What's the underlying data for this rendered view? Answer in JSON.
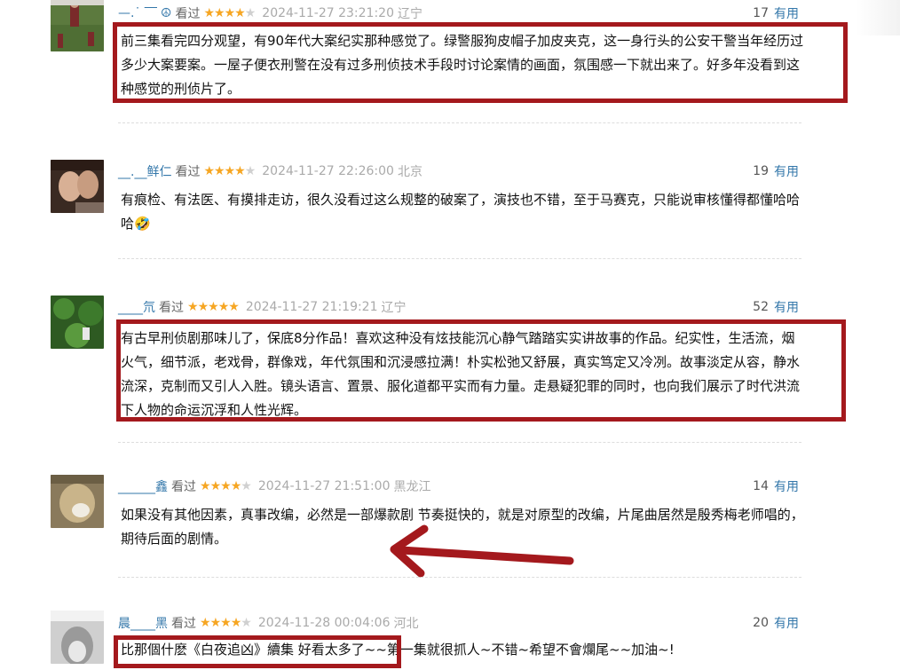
{
  "reviews": [
    {
      "username": "—.˙ ‾‾",
      "watched": "看过",
      "rating": 4,
      "time": "2024-11-27 23:21:20",
      "location": "辽宁",
      "votes": "17",
      "useful": "有用",
      "content": "前三集看完四分观望，有90年代大案纪实那种感觉了。绿警服狗皮帽子加皮夹克，这一身行头的公安干警当年经历过多少大案要案。一屋子便衣刑警在没有过多刑侦技术手段时讨论案情的画面，氛围感一下就出来了。好多年没看到这种感觉的刑侦片了。"
    },
    {
      "username": "__.__鲜仁",
      "watched": "看过",
      "rating": 4,
      "time": "2024-11-27 22:26:00",
      "location": "北京",
      "votes": "19",
      "useful": "有用",
      "content": "有痕检、有法医、有摸排走访，很久没看过这么规整的破案了，演技也不错，至于马赛克，只能说审核懂得都懂哈哈哈🤣"
    },
    {
      "username": "____氘",
      "watched": "看过",
      "rating": 5,
      "time": "2024-11-27 21:19:21",
      "location": "辽宁",
      "votes": "52",
      "useful": "有用",
      "content": "有古早刑侦剧那味儿了，保底8分作品！喜欢这种没有炫技能沉心静气踏踏实实讲故事的作品。纪实性，生活流，烟火气，细节派，老戏骨，群像戏，年代氛围和沉浸感拉满！朴实松弛又舒展，真实笃定又冷冽。故事淡定从容，静水流深，克制而又引人入胜。镜头语言、置景、服化道都平实而有力量。走悬疑犯罪的同时，也向我们展示了时代洪流下人物的命运沉浮和人性光辉。"
    },
    {
      "username": "______鑫",
      "watched": "看过",
      "rating": 4,
      "time": "2024-11-27 21:51:00",
      "location": "黑龙江",
      "votes": "14",
      "useful": "有用",
      "content": "如果没有其他因素，真事改编，必然是一部爆款剧 节奏挺快的，就是对原型的改编，片尾曲居然是殷秀梅老师唱的，期待后面的剧情。"
    },
    {
      "username": "晨____黑",
      "watched": "看过",
      "rating": 4,
      "time": "2024-11-28 00:04:06",
      "location": "河北",
      "votes": "20",
      "useful": "有用",
      "content": "比那個什麽《白夜追凶》續集 好看太多了~~第一集就很抓人~不错~希望不會爛尾~~加油~!"
    }
  ],
  "colors": {
    "highlight": "#a4191d",
    "link": "#3377aa",
    "star_on": "#f6a623",
    "star_off": "#d0d0d0"
  },
  "icons": {
    "star": "★",
    "annotation_arrow": "arrow-left"
  }
}
